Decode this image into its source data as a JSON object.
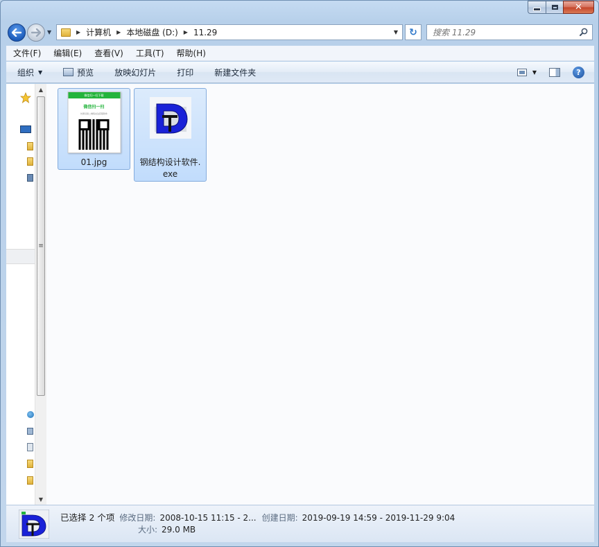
{
  "titlebar": {
    "minimize_icon": "minimize-icon",
    "maximize_icon": "maximize-icon",
    "close_label": "✕"
  },
  "navbar": {
    "breadcrumb": [
      "计算机",
      "本地磁盘 (D:)",
      "11.29"
    ],
    "refresh_glyph": "↻",
    "search_placeholder": "搜索 11.29"
  },
  "menubar": {
    "items": [
      "文件(F)",
      "编辑(E)",
      "查看(V)",
      "工具(T)",
      "帮助(H)"
    ]
  },
  "commandbar": {
    "organize": "组织",
    "preview": "预览",
    "slideshow": "放映幻灯片",
    "print": "打印",
    "new_folder": "新建文件夹",
    "help_glyph": "?"
  },
  "files": [
    {
      "name": "01.jpg",
      "type": "image",
      "thumb_band": "微信扫一扫下载",
      "thumb_heading": "微信扫一扫",
      "thumb_caption": "长按识别二维码关注获取软件"
    },
    {
      "name": "钢结构设计软件.exe",
      "name_line1": "钢结构设计软件.",
      "name_line2": "exe",
      "type": "application"
    }
  ],
  "status": {
    "selected": "已选择 2 个项",
    "modified_key": "修改日期:",
    "modified_value": "2008-10-15 11:15 - 2...",
    "created_key": "创建日期:",
    "created_value": "2019-09-19 14:59 - 2019-11-29 9:04",
    "size_key": "大小:",
    "size_value": "29.0 MB"
  },
  "colors": {
    "selection_fill": "#c1dcfc",
    "selection_border": "#84acdd",
    "exe_icon_blue": "#1a22d8"
  }
}
